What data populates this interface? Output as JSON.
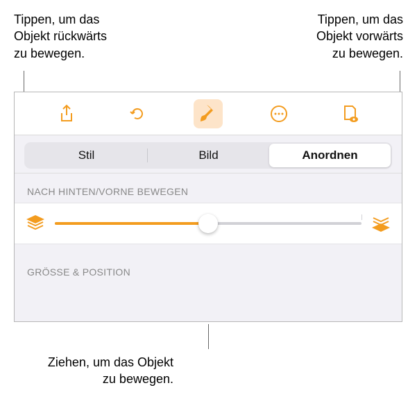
{
  "callouts": {
    "topLeft": "Tippen, um das\nObjekt rückwärts\nzu bewegen.",
    "topRight": "Tippen, um das\nObjekt vorwärts\nzu bewegen.",
    "bottom": "Ziehen, um das Objekt\nzu bewegen."
  },
  "tabs": {
    "style": "Stil",
    "image": "Bild",
    "arrange": "Anordnen"
  },
  "sections": {
    "layerTitle": "Nach hinten/vorne bewegen",
    "sizeTitle": "Größe & Position"
  },
  "slider": {
    "percent": 50
  },
  "colors": {
    "accent": "#f39c1f"
  }
}
